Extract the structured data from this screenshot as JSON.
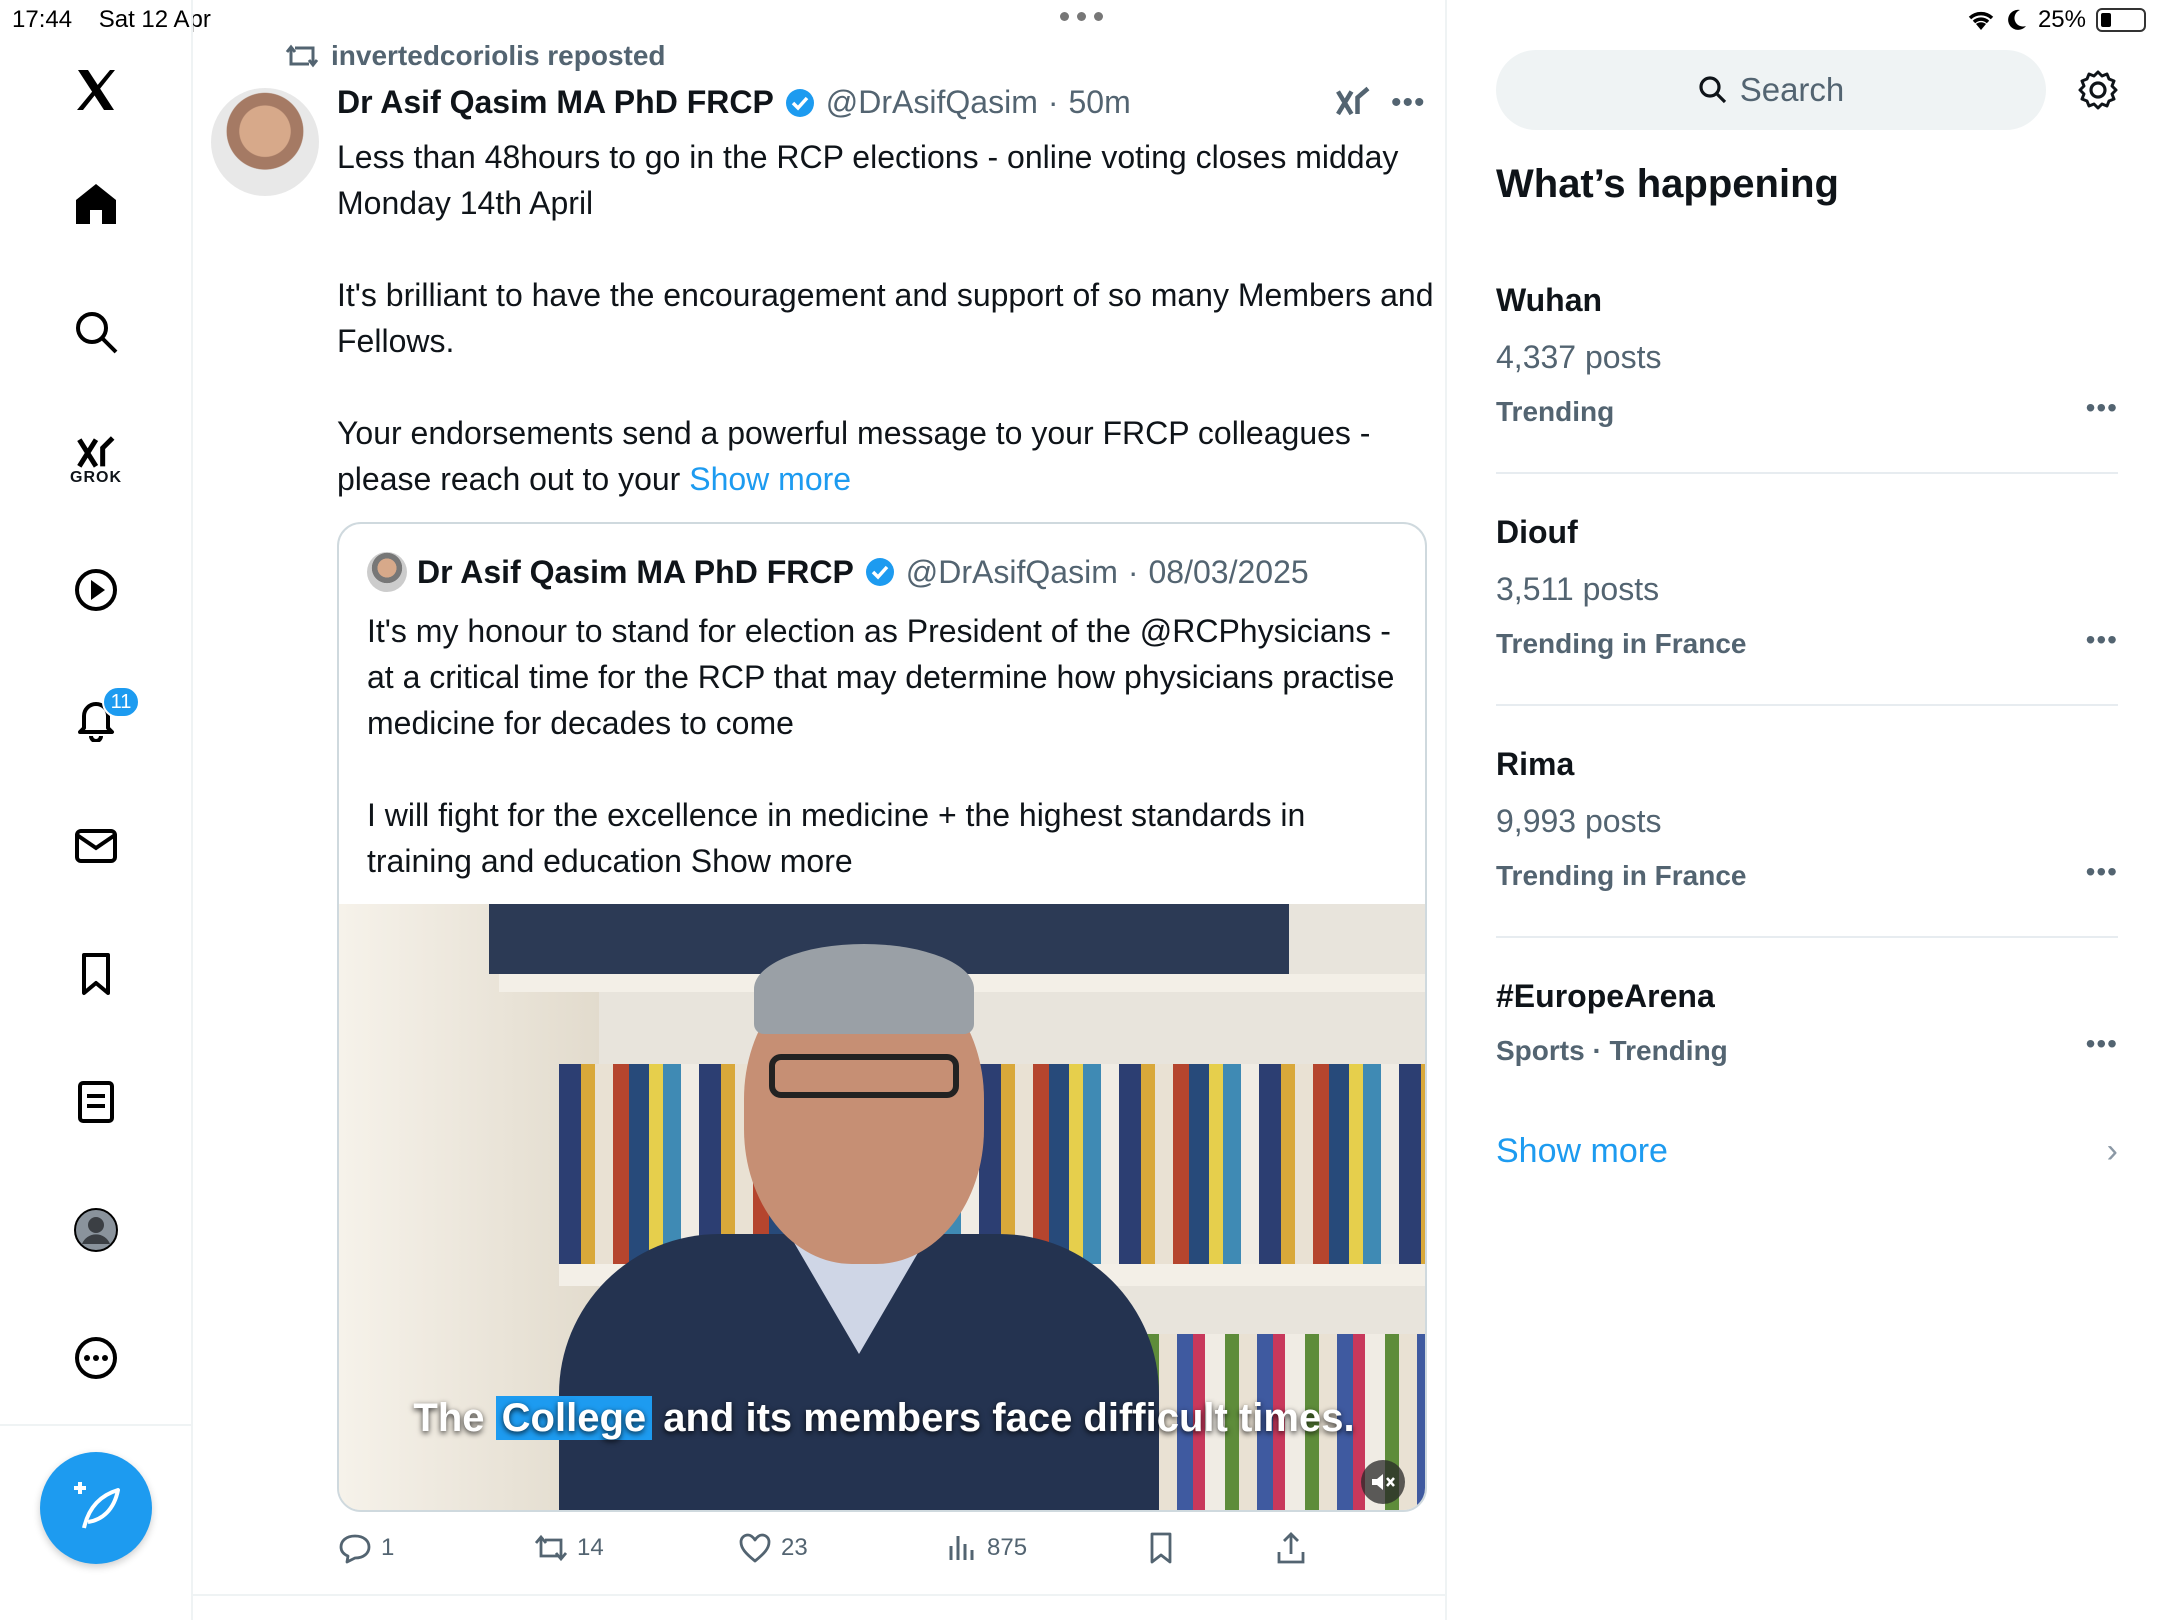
{
  "status_bar": {
    "time": "17:44",
    "date": "Sat 12 Apr",
    "battery": "25%",
    "battery_level": 0.25
  },
  "sidebar": {
    "items": [
      {
        "name": "x-logo",
        "icon": "x-logo-icon"
      },
      {
        "name": "home",
        "icon": "home-icon"
      },
      {
        "name": "explore",
        "icon": "search-icon"
      },
      {
        "name": "grok",
        "icon": "grok-icon",
        "label": "GROK"
      },
      {
        "name": "videos",
        "icon": "play-icon"
      },
      {
        "name": "notifications",
        "icon": "bell-icon",
        "badge": "11"
      },
      {
        "name": "messages",
        "icon": "mail-icon"
      },
      {
        "name": "bookmarks",
        "icon": "bookmark-icon"
      },
      {
        "name": "lists",
        "icon": "list-icon"
      },
      {
        "name": "profile",
        "icon": "avatar-icon"
      },
      {
        "name": "more",
        "icon": "more-icon"
      }
    ],
    "compose": "compose-icon"
  },
  "tweet": {
    "repost_label": "invertedcoriolis reposted",
    "author_name": "Dr Asif Qasim MA PhD FRCP",
    "handle": "@DrAsifQasim",
    "separator": "·",
    "time": "50m",
    "text_p1": "Less than 48hours to go in the RCP elections - online voting closes midday Monday 14th April",
    "text_p2": "It's brilliant to have the encouragement and support of so many Members and Fellows.",
    "text_p3": "Your endorsements  send a powerful message to your FRCP colleagues - please reach out to your ",
    "show_more": "Show more",
    "quote": {
      "author_name": "Dr Asif Qasim MA PhD FRCP",
      "handle": "@DrAsifQasim",
      "separator": "·",
      "date": "08/03/2025",
      "text_p1": "It's my honour to stand for election as President of the @RCPhysicians - at a critical time for the RCP that may determine how physicians practise medicine for decades to come",
      "text_p2": "I will fight for the excellence in medicine + the highest standards in training and education Show more",
      "caption_before": "The ",
      "caption_highlight": "College",
      "caption_after": " and its members face difficult times."
    },
    "actions": {
      "replies": "1",
      "reposts": "14",
      "likes": "23",
      "views": "875"
    }
  },
  "right": {
    "search_placeholder": "Search",
    "section_title": "What’s happening",
    "trends": [
      {
        "title": "Wuhan",
        "posts": "4,337 posts",
        "meta": "Trending"
      },
      {
        "title": "Diouf",
        "posts": "3,511 posts",
        "meta": "Trending in France"
      },
      {
        "title": "Rima",
        "posts": "9,993 posts",
        "meta": "Trending in France"
      },
      {
        "title": "#EuropeArena",
        "posts": "",
        "meta": "Sports · Trending"
      }
    ],
    "show_more": "Show more"
  },
  "colors": {
    "accent": "#1d9bf0",
    "secondary_text": "#536471",
    "border": "#eff3f4"
  }
}
